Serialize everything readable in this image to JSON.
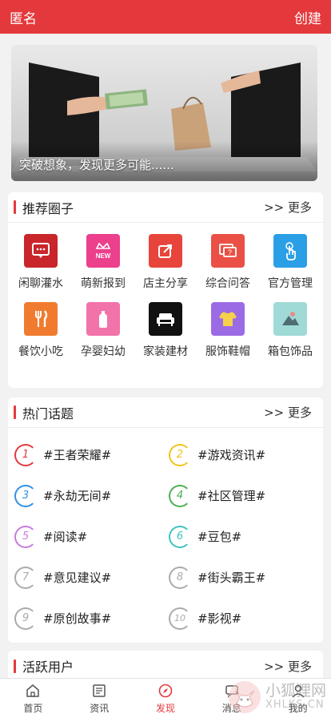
{
  "header": {
    "title": "匿名",
    "action": "创建"
  },
  "banner": {
    "caption": "突破想象，发现更多可能......"
  },
  "circles": {
    "title": "推荐圈子",
    "more": ">> 更多",
    "items": [
      {
        "label": "闲聊灌水",
        "color": "#c9262b",
        "icon": "chat-bubble-icon"
      },
      {
        "label": "萌新报到",
        "color": "#ec3f8c",
        "icon": "crown-new-icon"
      },
      {
        "label": "店主分享",
        "color": "#e7453b",
        "icon": "share-icon"
      },
      {
        "label": "综合问答",
        "color": "#ea5045",
        "icon": "question-icon"
      },
      {
        "label": "官方管理",
        "color": "#2b9fe6",
        "icon": "tap-hand-icon"
      },
      {
        "label": "餐饮小吃",
        "color": "#f07b2f",
        "icon": "fork-knife-icon"
      },
      {
        "label": "孕婴妇幼",
        "color": "#f173a9",
        "icon": "baby-bottle-icon"
      },
      {
        "label": "家装建材",
        "color": "#111111",
        "icon": "sofa-icon"
      },
      {
        "label": "服饰鞋帽",
        "color": "#9b6be6",
        "icon": "tshirt-icon"
      },
      {
        "label": "箱包饰品",
        "color": "#9fdad7",
        "icon": "bag-icon"
      }
    ]
  },
  "topics": {
    "title": "热门话题",
    "more": ">> 更多",
    "items": [
      {
        "num": "1",
        "text": "#王者荣耀#",
        "color": "#e4393c"
      },
      {
        "num": "2",
        "text": "#游戏资讯#",
        "color": "#f0c419"
      },
      {
        "num": "3",
        "text": "#永劫无间#",
        "color": "#2f8fe6"
      },
      {
        "num": "4",
        "text": "#社区管理#",
        "color": "#4caf50"
      },
      {
        "num": "5",
        "text": "#阅读#",
        "color": "#c77be0"
      },
      {
        "num": "6",
        "text": "#豆包#",
        "color": "#3fc2c2"
      },
      {
        "num": "7",
        "text": "#意见建议#",
        "color": "#aaaaaa"
      },
      {
        "num": "8",
        "text": "#街头霸王#",
        "color": "#aaaaaa"
      },
      {
        "num": "9",
        "text": "#原创故事#",
        "color": "#aaaaaa"
      },
      {
        "num": "10",
        "text": "#影视#",
        "color": "#aaaaaa"
      }
    ]
  },
  "users": {
    "title": "活跃用户",
    "more": ">> 更多"
  },
  "tabs": [
    {
      "label": "首页",
      "icon": "home-icon"
    },
    {
      "label": "资讯",
      "icon": "news-icon"
    },
    {
      "label": "发现",
      "icon": "compass-icon"
    },
    {
      "label": "消息",
      "icon": "message-icon"
    },
    {
      "label": "我的",
      "icon": "user-icon"
    }
  ],
  "watermark": {
    "text": "小狐狸网",
    "sub": "XHLKS.CN"
  }
}
